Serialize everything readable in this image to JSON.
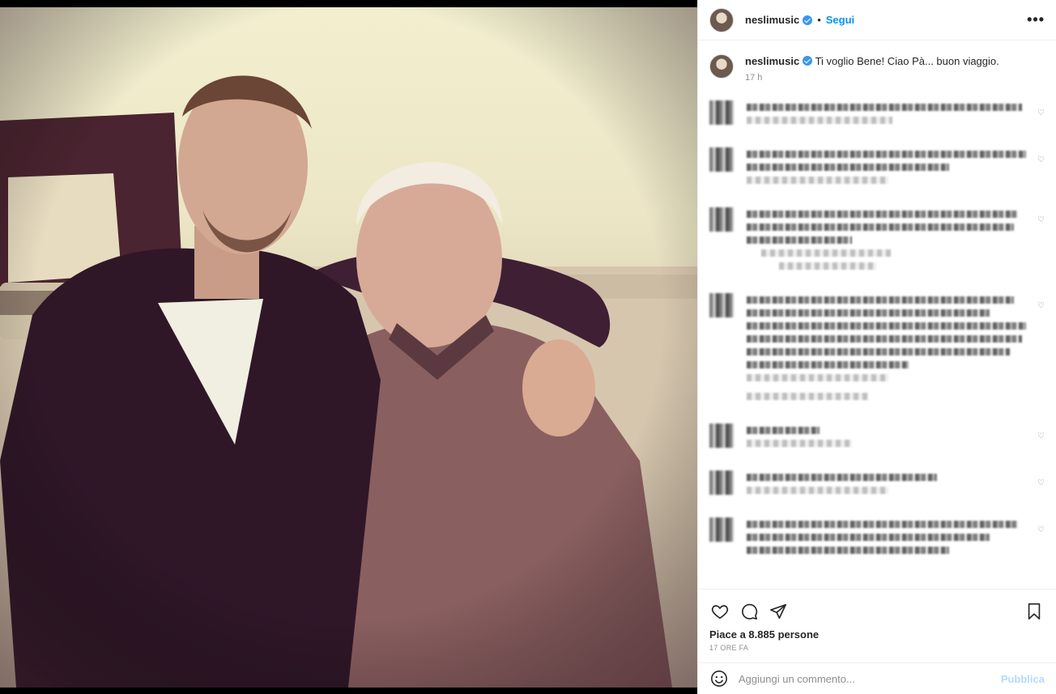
{
  "post": {
    "username": "neslimusic",
    "follow_label": "Segui",
    "separator": "•",
    "more_label": "•••"
  },
  "caption": {
    "username": "neslimusic",
    "text": "Ti voglio Bene! Ciao Pà... buon viaggio.",
    "time": "17 h"
  },
  "actions": {
    "likes": "Piace a 8.885 persone",
    "ago": "17 ORE FA"
  },
  "comment_box": {
    "placeholder": "Aggiungi un commento...",
    "publish_label": "Pubblica"
  },
  "colors": {
    "accent": "#0095f6",
    "verified": "#3897f0",
    "publish_disabled": "#b3dbff",
    "text": "#262626",
    "muted": "#8e8e8e"
  },
  "icons": [
    "verified-icon",
    "more-icon",
    "heart-icon",
    "comment-icon",
    "share-icon",
    "bookmark-icon",
    "emoji-icon"
  ]
}
